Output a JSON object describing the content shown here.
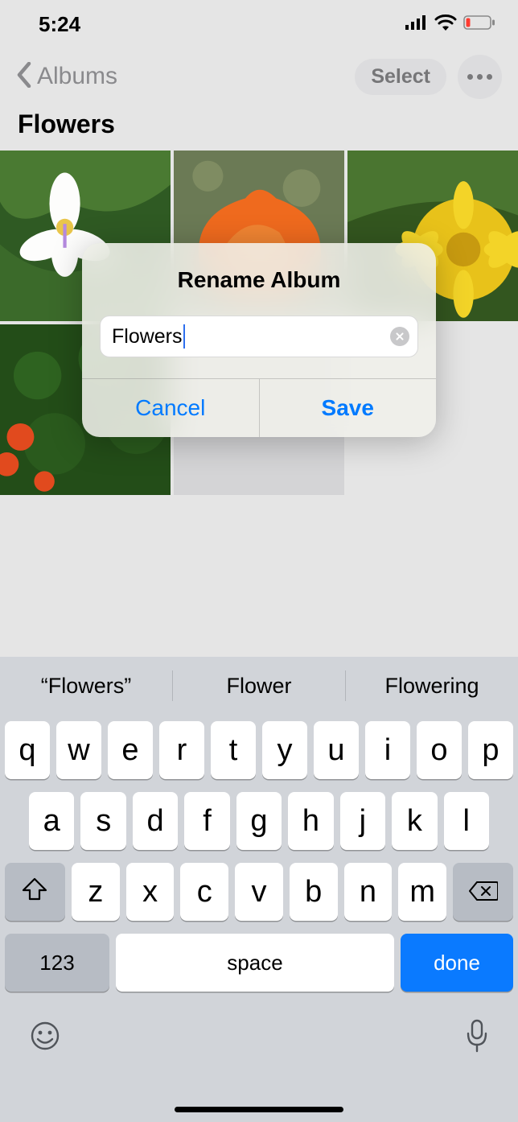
{
  "status": {
    "time": "5:24"
  },
  "nav": {
    "back_label": "Albums",
    "select_label": "Select"
  },
  "page": {
    "title": "Flowers"
  },
  "modal": {
    "title": "Rename Album",
    "input_value": "Flowers",
    "cancel_label": "Cancel",
    "save_label": "Save"
  },
  "keyboard": {
    "suggestions": [
      "“Flowers”",
      "Flower",
      "Flowering"
    ],
    "row1": [
      "q",
      "w",
      "e",
      "r",
      "t",
      "y",
      "u",
      "i",
      "o",
      "p"
    ],
    "row2": [
      "a",
      "s",
      "d",
      "f",
      "g",
      "h",
      "j",
      "k",
      "l"
    ],
    "row3": [
      "z",
      "x",
      "c",
      "v",
      "b",
      "n",
      "m"
    ],
    "numbers_label": "123",
    "space_label": "space",
    "done_label": "done"
  }
}
